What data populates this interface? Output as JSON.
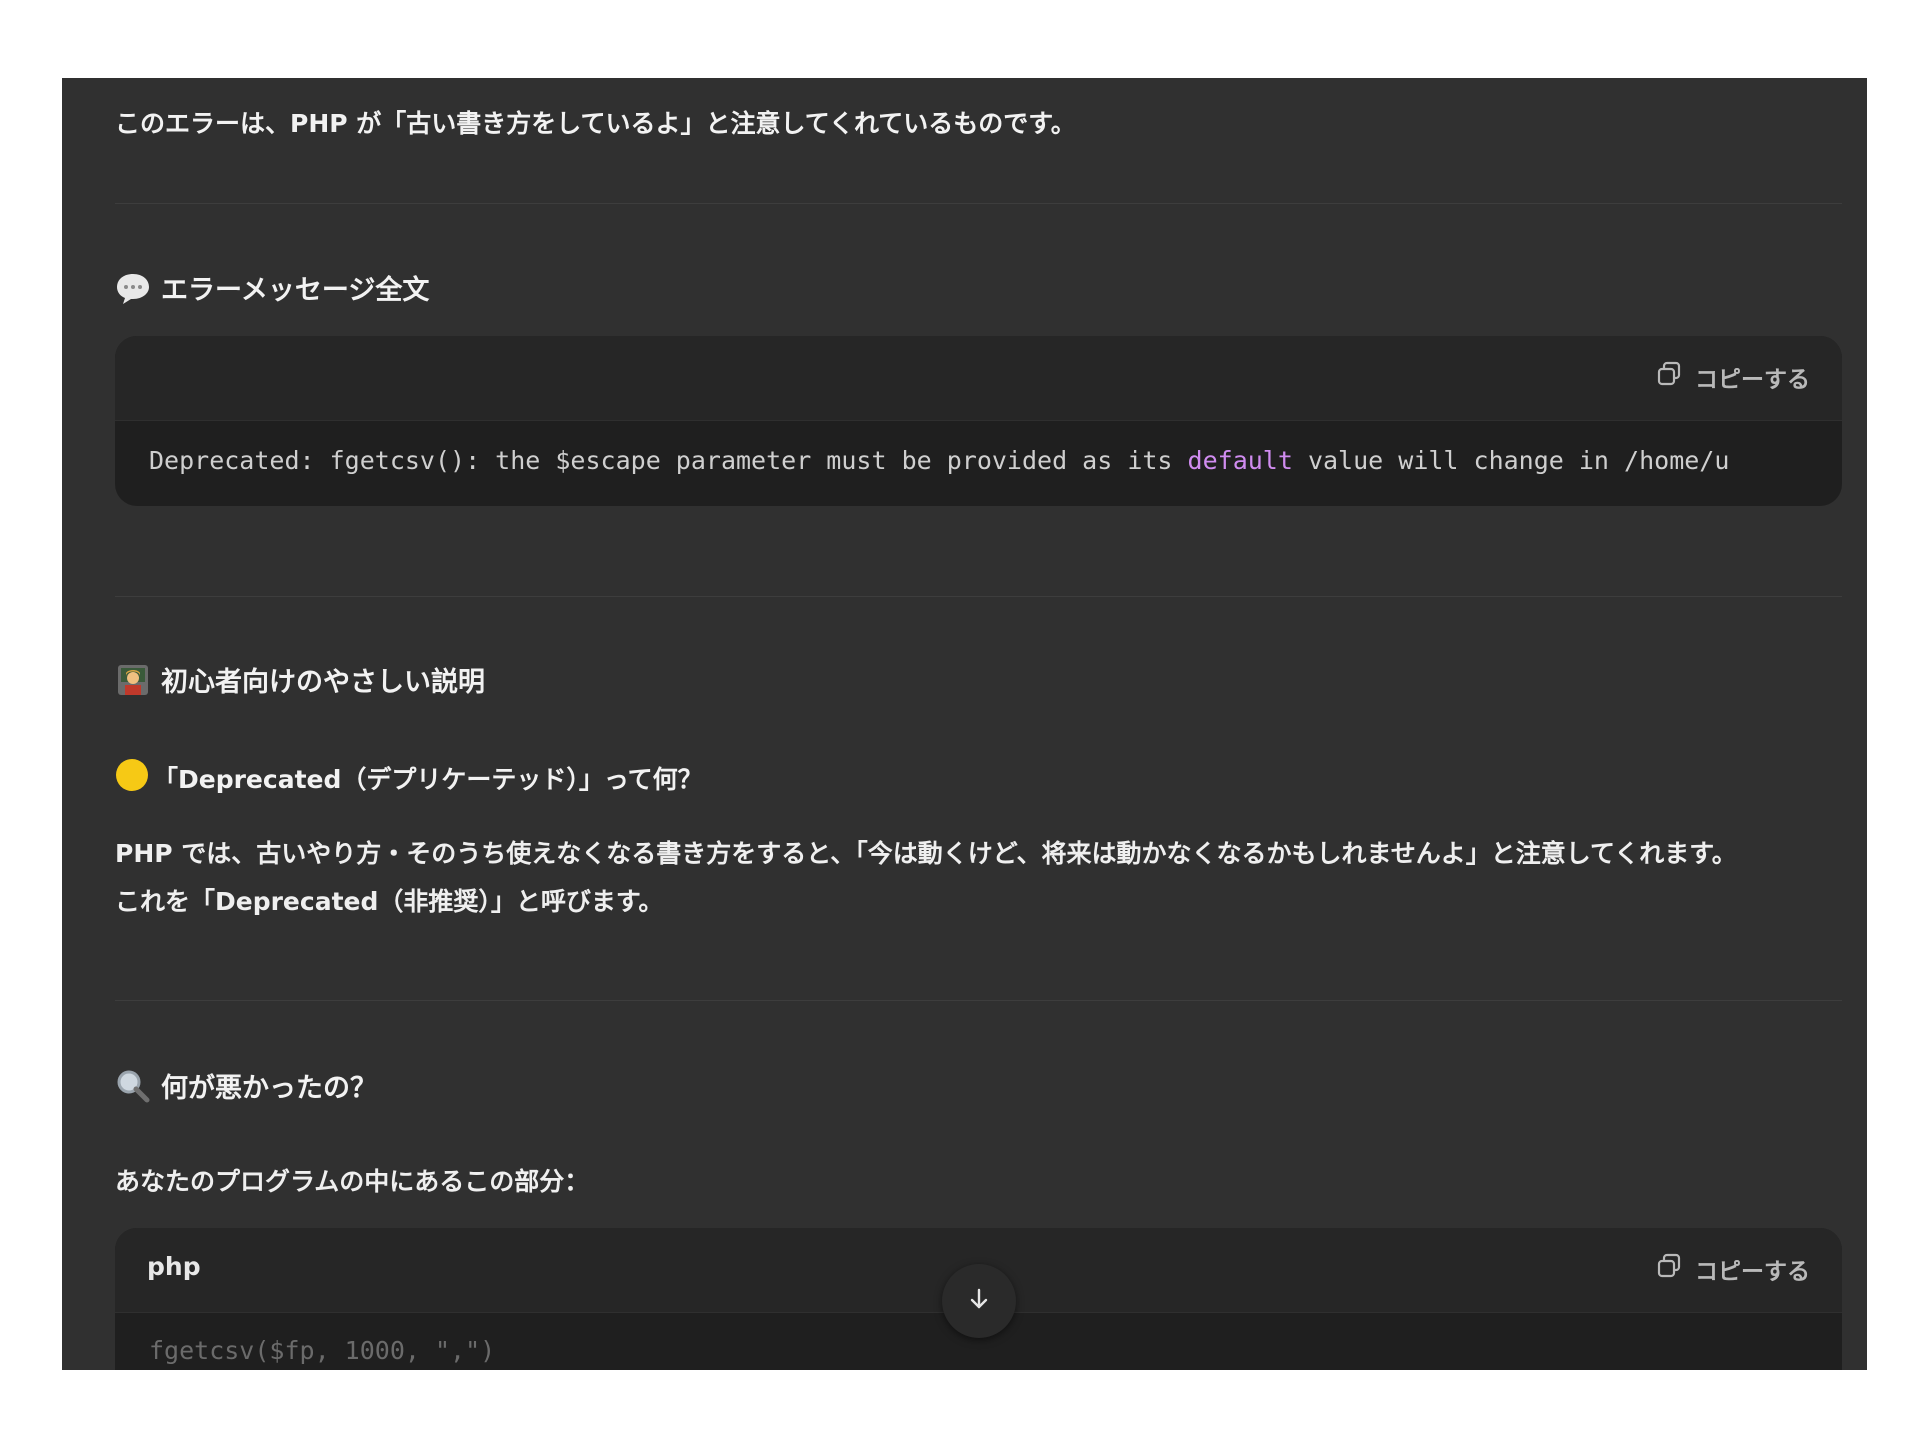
{
  "intro": "このエラーは、PHP が「古い書き方をしているよ」と注意してくれているものです。",
  "section_error": {
    "icon": "speech-bubble-icon",
    "title": "エラーメッセージ全文",
    "copy_label": "コピーする",
    "code_before": "Deprecated: fgetcsv(): the $escape parameter must be provided as its ",
    "code_keyword": "default",
    "code_after": " value will change in /home/u"
  },
  "section_beginner": {
    "icon": "teacher-icon",
    "title": "初心者向けのやさしい説明",
    "sub_icon": "yellow-circle-icon",
    "subheading": "「Deprecated（デプリケーテッド）」って何？",
    "para_line1": "PHP では、古いやり方・そのうち使えなくなる書き方をすると、「今は動くけど、将来は動かなくなるかもしれませんよ」と注意してくれます。",
    "para_line2": "これを「Deprecated（非推奨）」と呼びます。"
  },
  "section_cause": {
    "icon": "magnifier-icon",
    "title": "何が悪かったの？",
    "lead": "あなたのプログラムの中にあるこの部分：",
    "lang": "php",
    "copy_label": "コピーする",
    "code": "fgetcsv($fp, 1000, \",\")"
  },
  "colors": {
    "panel_bg": "#303030",
    "code_bg": "#1f1f1f",
    "keyword": "#d08cf0"
  }
}
